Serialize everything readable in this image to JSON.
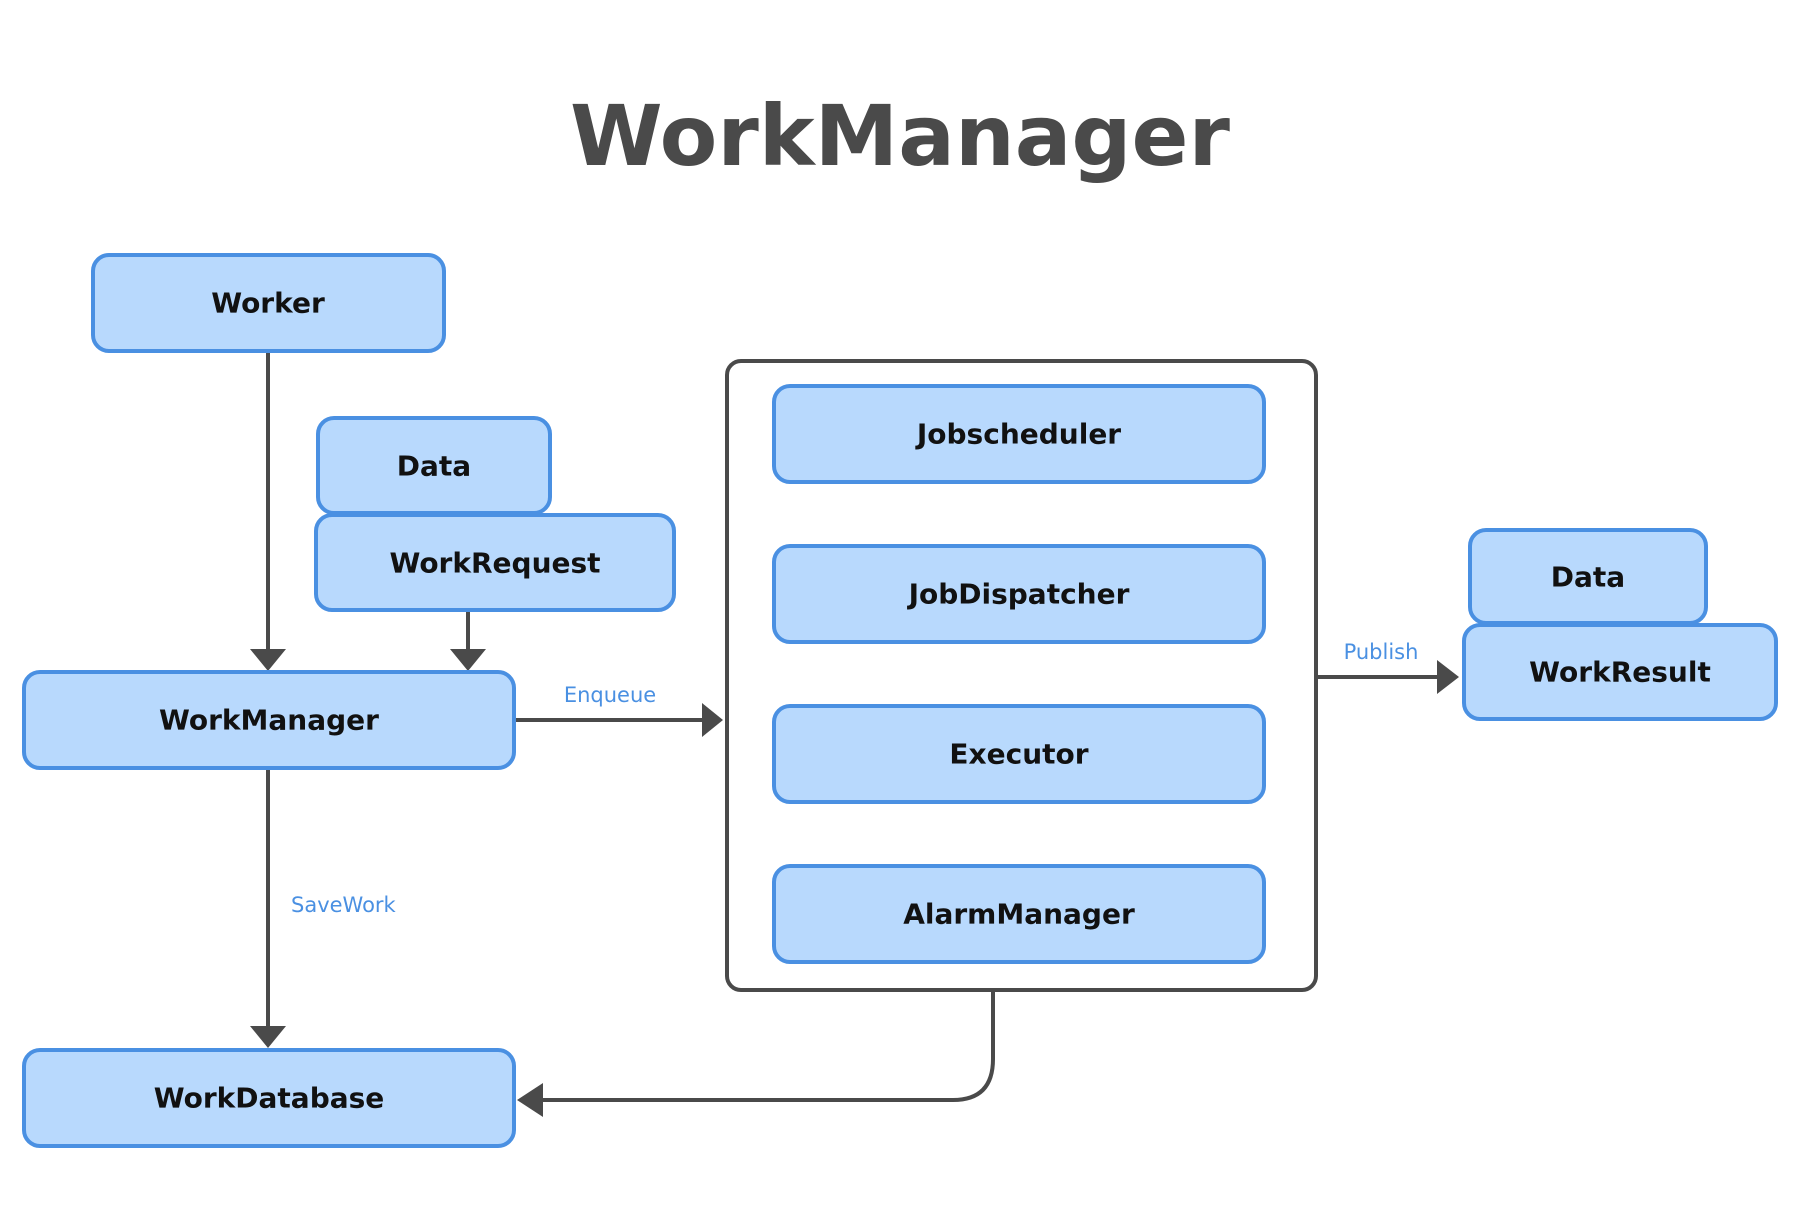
{
  "title": "WorkManager",
  "colors": {
    "node_fill": "#b8d9fd",
    "node_stroke": "#4a90e2",
    "edge": "#4a4a4a",
    "edge_label": "#4a90e2",
    "title": "#4a4a4a"
  },
  "nodes": {
    "worker": "Worker",
    "data_in": "Data",
    "work_request": "WorkRequest",
    "work_manager": "WorkManager",
    "work_database": "WorkDatabase",
    "jobscheduler": "Jobscheduler",
    "job_dispatcher": "JobDispatcher",
    "executor": "Executor",
    "alarm_manager": "AlarmManager",
    "data_out": "Data",
    "work_result": "WorkResult"
  },
  "edges": [
    {
      "from": "Worker",
      "to": "WorkManager",
      "label": ""
    },
    {
      "from": "WorkRequest",
      "to": "WorkManager",
      "label": ""
    },
    {
      "from": "WorkManager",
      "to": "Scheduler group",
      "label": "Enqueue"
    },
    {
      "from": "WorkManager",
      "to": "WorkDatabase",
      "label": "SaveWork"
    },
    {
      "from": "Scheduler group",
      "to": "WorkResult",
      "label": "Publish"
    },
    {
      "from": "Scheduler group",
      "to": "WorkDatabase",
      "label": ""
    }
  ],
  "edge_labels": {
    "enqueue": "Enqueue",
    "save_work": "SaveWork",
    "publish": "Publish"
  }
}
